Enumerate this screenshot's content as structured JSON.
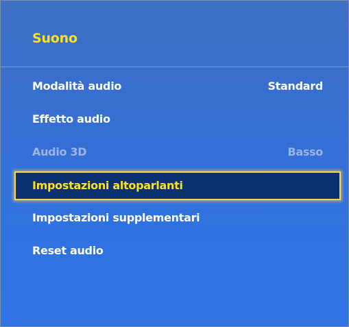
{
  "menu": {
    "title": "Suono",
    "items": [
      {
        "label": "Modalità audio",
        "value": "Standard",
        "state": "normal"
      },
      {
        "label": "Effetto audio",
        "value": "",
        "state": "normal"
      },
      {
        "label": "Audio 3D",
        "value": "Basso",
        "state": "disabled"
      },
      {
        "label": "Impostazioni altoparlanti",
        "value": "",
        "state": "selected"
      },
      {
        "label": "Impostazioni supplementari",
        "value": "",
        "state": "normal"
      },
      {
        "label": "Reset audio",
        "value": "",
        "state": "normal"
      }
    ]
  },
  "colors": {
    "background": "#3570d4",
    "title": "#ffe21a",
    "text": "#ffffff",
    "disabled_text": "#9ab6e4",
    "selected_background": "#0c3170",
    "selected_border": "#ffd54a"
  }
}
